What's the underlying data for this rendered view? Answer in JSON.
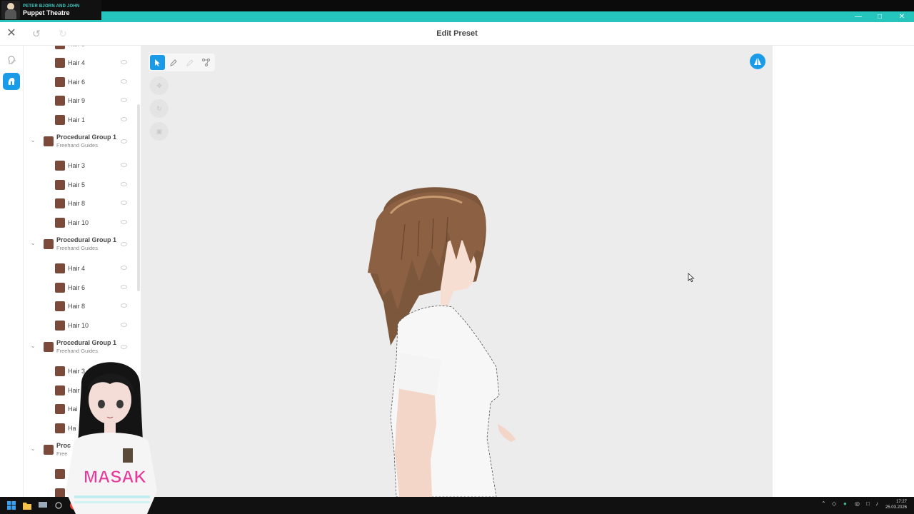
{
  "now_playing": {
    "artist": "PETER BJORN AND JOHN",
    "title": "Puppet Theatre"
  },
  "window": {
    "minimize": "—",
    "maximize": "□",
    "close": "✕"
  },
  "header": {
    "title": "Edit Preset",
    "close_icon": "✕",
    "undo_icon": "↺",
    "redo_icon": "↻"
  },
  "colors": {
    "accent": "#1a9be8",
    "titlebar": "#25c4bc",
    "hair_swatch": "#7b4a3b",
    "viewport_bg": "#ececec"
  },
  "layers": {
    "top": [
      {
        "label": "Hair 4"
      },
      {
        "label": "Hair 6"
      },
      {
        "label": "Hair 9"
      },
      {
        "label": "Hair 1"
      }
    ],
    "groups": [
      {
        "title": "Procedural Group 1",
        "subtitle": "Freehand Guides",
        "items": [
          {
            "label": "Hair 3"
          },
          {
            "label": "Hair 5"
          },
          {
            "label": "Hair 8"
          },
          {
            "label": "Hair 10"
          }
        ]
      },
      {
        "title": "Procedural Group 1",
        "subtitle": "Freehand Guides",
        "items": [
          {
            "label": "Hair 4"
          },
          {
            "label": "Hair 6"
          },
          {
            "label": "Hair 8"
          },
          {
            "label": "Hair 10"
          }
        ]
      },
      {
        "title": "Procedural Group 1",
        "subtitle": "Freehand Guides",
        "items": [
          {
            "label": "Hair 3"
          },
          {
            "label": "Hair"
          },
          {
            "label": "Hai"
          },
          {
            "label": "Ha"
          }
        ]
      },
      {
        "title": "Proc",
        "subtitle": "Free"
      }
    ]
  },
  "avatar_shirt_text": "MASAK",
  "taskbar": {
    "time": "17:27",
    "date": "25.03.2026"
  }
}
